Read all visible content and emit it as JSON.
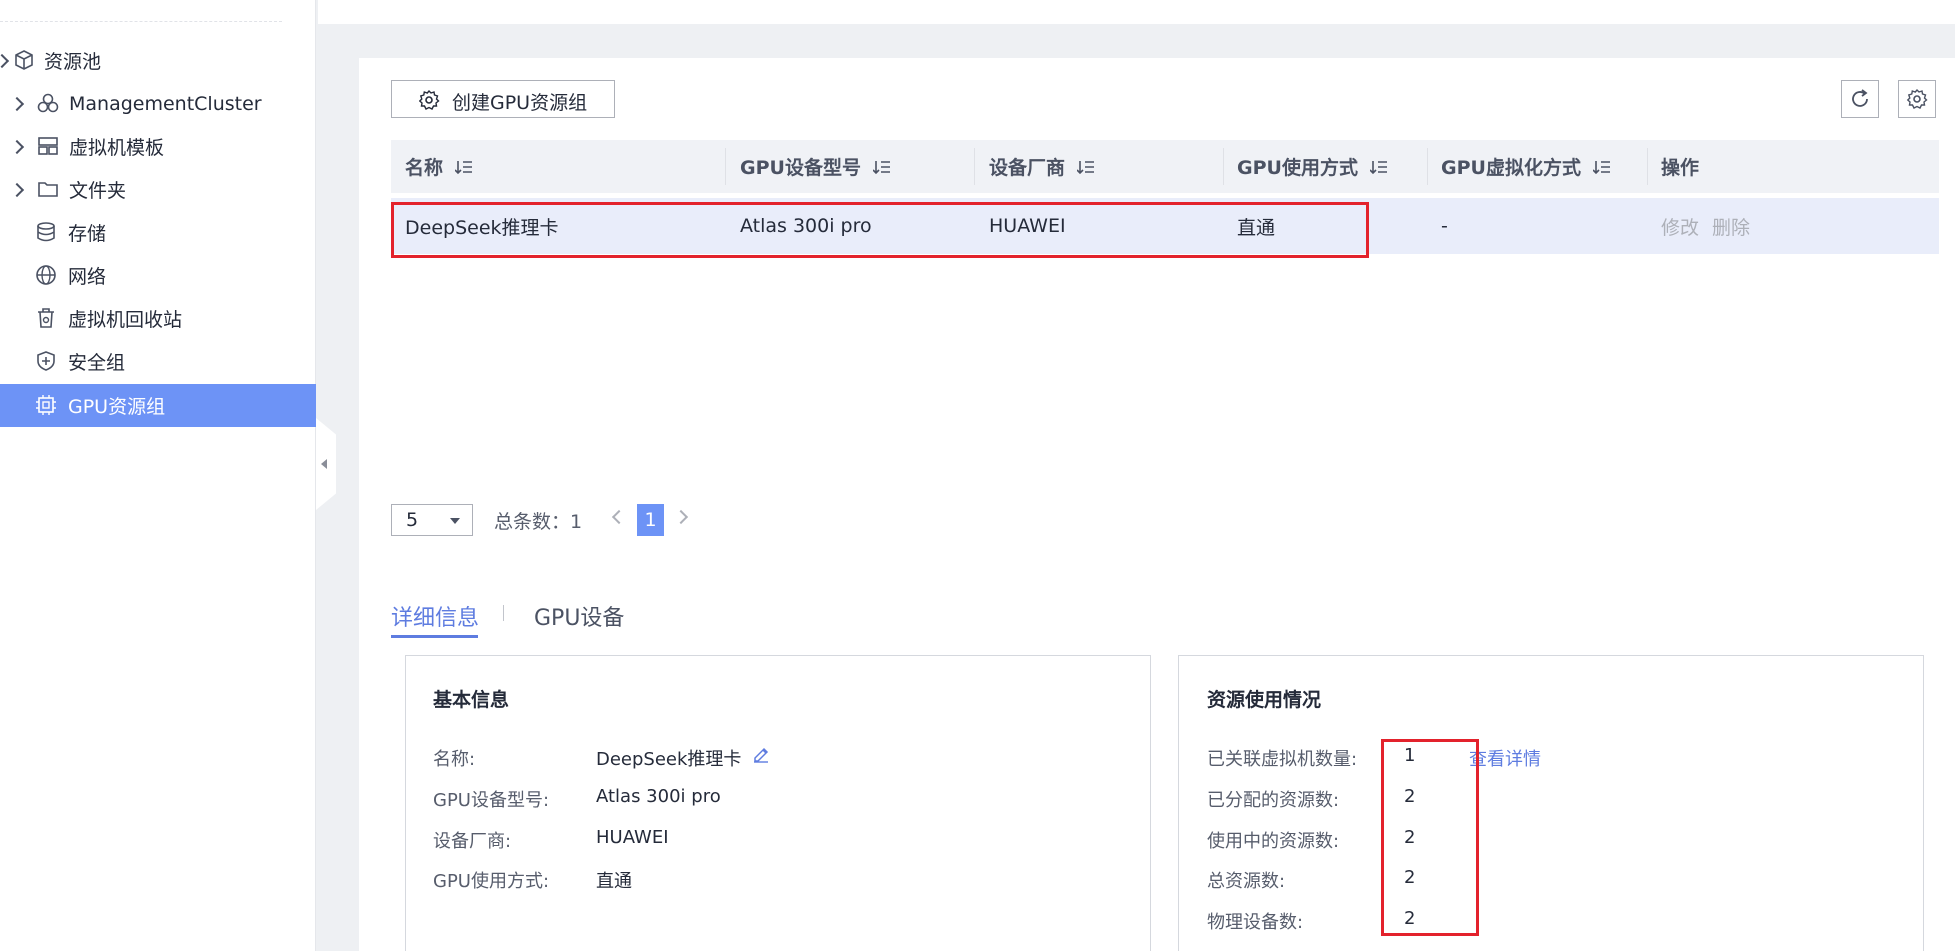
{
  "sidebar": {
    "items": [
      {
        "label": "资源池",
        "icon": "cube-icon",
        "expandable": false
      },
      {
        "label": "ManagementCluster",
        "icon": "cluster-icon",
        "expandable": true
      },
      {
        "label": "虚拟机模板",
        "icon": "template-icon",
        "expandable": true
      },
      {
        "label": "文件夹",
        "icon": "folder-icon",
        "expandable": true
      },
      {
        "label": "存储",
        "icon": "database-icon",
        "expandable": false
      },
      {
        "label": "网络",
        "icon": "globe-icon",
        "expandable": false
      },
      {
        "label": "虚拟机回收站",
        "icon": "recycle-bin-icon",
        "expandable": false
      },
      {
        "label": "安全组",
        "icon": "shield-icon",
        "expandable": false
      },
      {
        "label": "GPU资源组",
        "icon": "chip-icon",
        "expandable": false,
        "active": true
      }
    ]
  },
  "toolbar": {
    "create_label": "创建GPU资源组"
  },
  "table": {
    "columns": [
      "名称",
      "GPU设备型号",
      "设备厂商",
      "GPU使用方式",
      "GPU虚拟化方式",
      "操作"
    ],
    "rows": [
      {
        "name": "DeepSeek推理卡",
        "model": "Atlas 300i pro",
        "vendor": "HUAWEI",
        "usage": "直通",
        "virt": "-",
        "edit": "修改",
        "delete": "删除"
      }
    ]
  },
  "pagination": {
    "page_size": "5",
    "total": "总条数：1",
    "current": "1"
  },
  "tabs": [
    "详细信息",
    "GPU设备"
  ],
  "basic_info": {
    "title": "基本信息",
    "name_label": "名称:",
    "name_value": "DeepSeek推理卡",
    "model_label": "GPU设备型号:",
    "model_value": "Atlas 300i pro",
    "vendor_label": "设备厂商:",
    "vendor_value": "HUAWEI",
    "usage_label": "GPU使用方式:",
    "usage_value": "直通"
  },
  "resource_usage": {
    "title": "资源使用情况",
    "vm_count_label": "已关联虚拟机数量:",
    "vm_count_value": "1",
    "view_details": "查看详情",
    "allocated_label": "已分配的资源数:",
    "allocated_value": "2",
    "in_use_label": "使用中的资源数:",
    "in_use_value": "2",
    "total_label": "总资源数:",
    "total_value": "2",
    "physical_label": "物理设备数:",
    "physical_value": "2"
  },
  "colors": {
    "accent": "#5e7ce0",
    "sidebar_active": "#6d93f6",
    "highlight_box": "#e3222c"
  }
}
